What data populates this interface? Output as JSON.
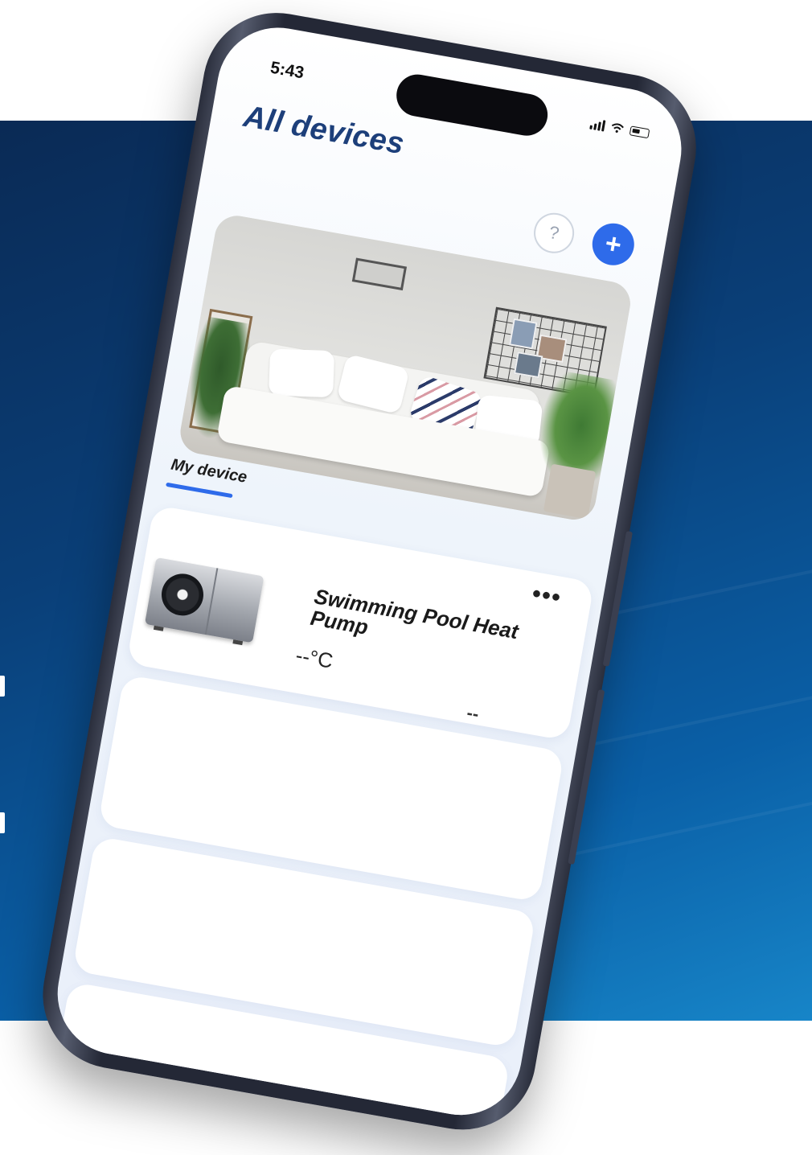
{
  "status_bar": {
    "time": "5:43",
    "icons": [
      "signal-icon",
      "wifi-icon",
      "battery-icon"
    ]
  },
  "header": {
    "title": "All devices",
    "help_label": "?",
    "add_label": "+",
    "accent_color": "#2e6bea",
    "title_color": "#1d3f7a"
  },
  "hero": {
    "image": "living-room-sofa-image"
  },
  "tabs": [
    {
      "label": "My device",
      "active": true
    }
  ],
  "devices": [
    {
      "name": "Swimming Pool Heat Pump",
      "temperature": "--°C",
      "status": "--",
      "more_label": "•••",
      "image": "heat-pump-image"
    }
  ],
  "placeholder_cards": 3,
  "background_colors": [
    "#0a2a55",
    "#0a5fa6",
    "#1785c8"
  ]
}
